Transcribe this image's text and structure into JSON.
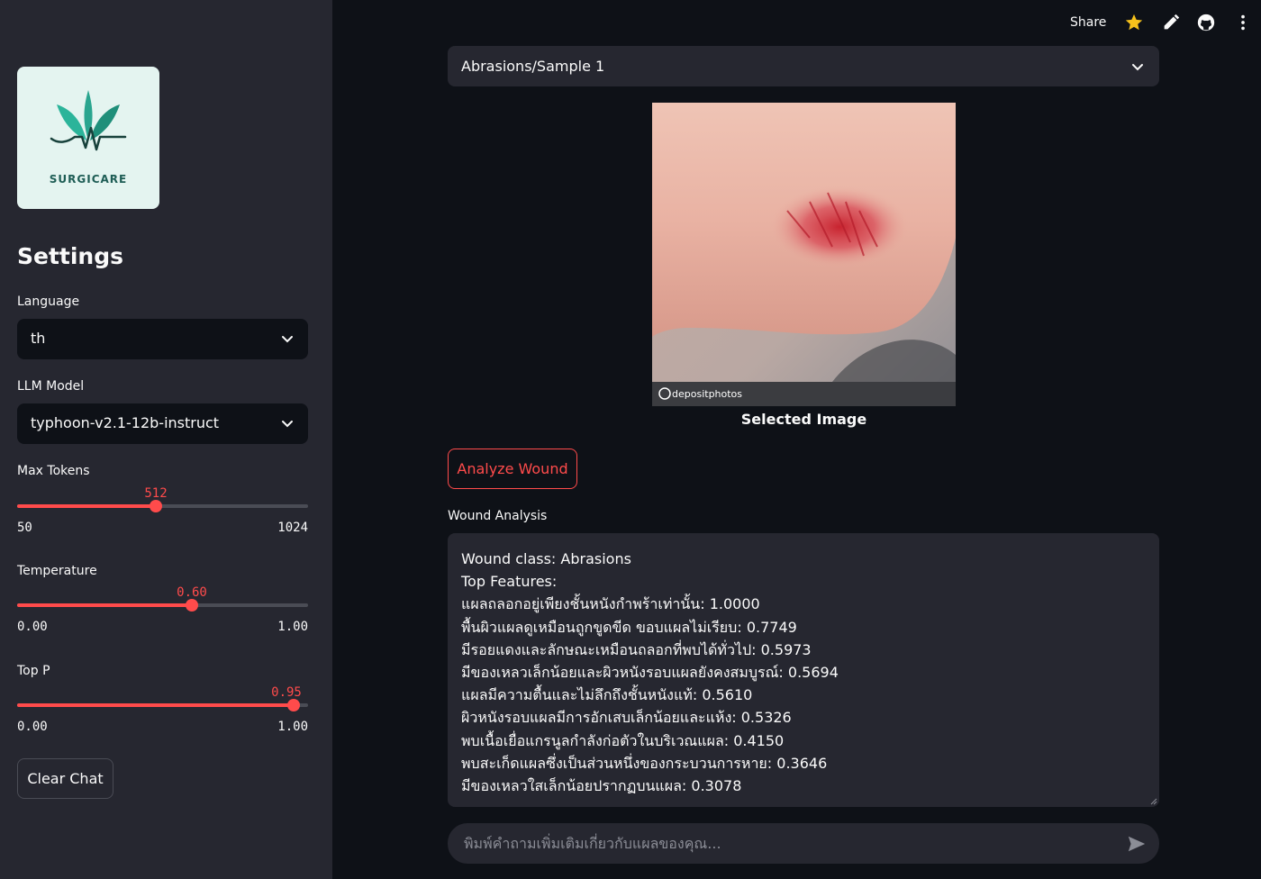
{
  "sidebar": {
    "logo_text": "SURGICARE",
    "heading": "Settings",
    "language": {
      "label": "Language",
      "value": "th"
    },
    "llm_model": {
      "label": "LLM Model",
      "value": "typhoon-v2.1-12b-instruct"
    },
    "max_tokens": {
      "label": "Max Tokens",
      "value": "512",
      "min": "50",
      "max": "1024",
      "fraction": 0.476
    },
    "temperature": {
      "label": "Temperature",
      "value": "0.60",
      "min": "0.00",
      "max": "1.00",
      "fraction": 0.6
    },
    "top_p": {
      "label": "Top P",
      "value": "0.95",
      "min": "0.00",
      "max": "1.00",
      "fraction": 0.95
    },
    "clear_chat_label": "Clear Chat"
  },
  "topbar": {
    "share_label": "Share",
    "icons": [
      "star-icon",
      "edit-icon",
      "github-icon",
      "more-icon"
    ]
  },
  "main": {
    "sample_select": {
      "value": "Abrasions/Sample 1"
    },
    "image_caption": "Selected Image",
    "image_watermark": "depositphotos",
    "analyze_label": "Analyze Wound",
    "analysis_label": "Wound Analysis",
    "analysis_lines": [
      "Wound class: Abrasions",
      "Top Features:",
      "แผลถลอกอยู่เพียงชั้นหนังกำพร้าเท่านั้น: 1.0000",
      "พื้นผิวแผลดูเหมือนถูกขูดขีด ขอบแผลไม่เรียบ: 0.7749",
      "มีรอยแดงและลักษณะเหมือนถลอกที่พบได้ทั่วไป: 0.5973",
      "มีของเหลวเล็กน้อยและผิวหนังรอบแผลยังคงสมบูรณ์: 0.5694",
      "แผลมีความตื้นและไม่ลึกถึงชั้นหนังแท้: 0.5610",
      "ผิวหนังรอบแผลมีการอักเสบเล็กน้อยและแห้ง: 0.5326",
      "พบเนื้อเยื่อแกรนูลกำลังก่อตัวในบริเวณแผล: 0.4150",
      "พบสะเก็ดแผลซึ่งเป็นส่วนหนึ่งของกระบวนการหาย: 0.3646",
      "มีของเหลวใสเล็กน้อยปรากฏบนแผล: 0.3078"
    ],
    "chat_placeholder": "พิมพ์คำถามเพิ่มเติมเกี่ยวกับแผลของคุณ..."
  },
  "colors": {
    "accent": "#ff4b4b",
    "sidebar_bg": "#262730",
    "main_bg": "#0e1117",
    "star": "#f7c21b"
  }
}
